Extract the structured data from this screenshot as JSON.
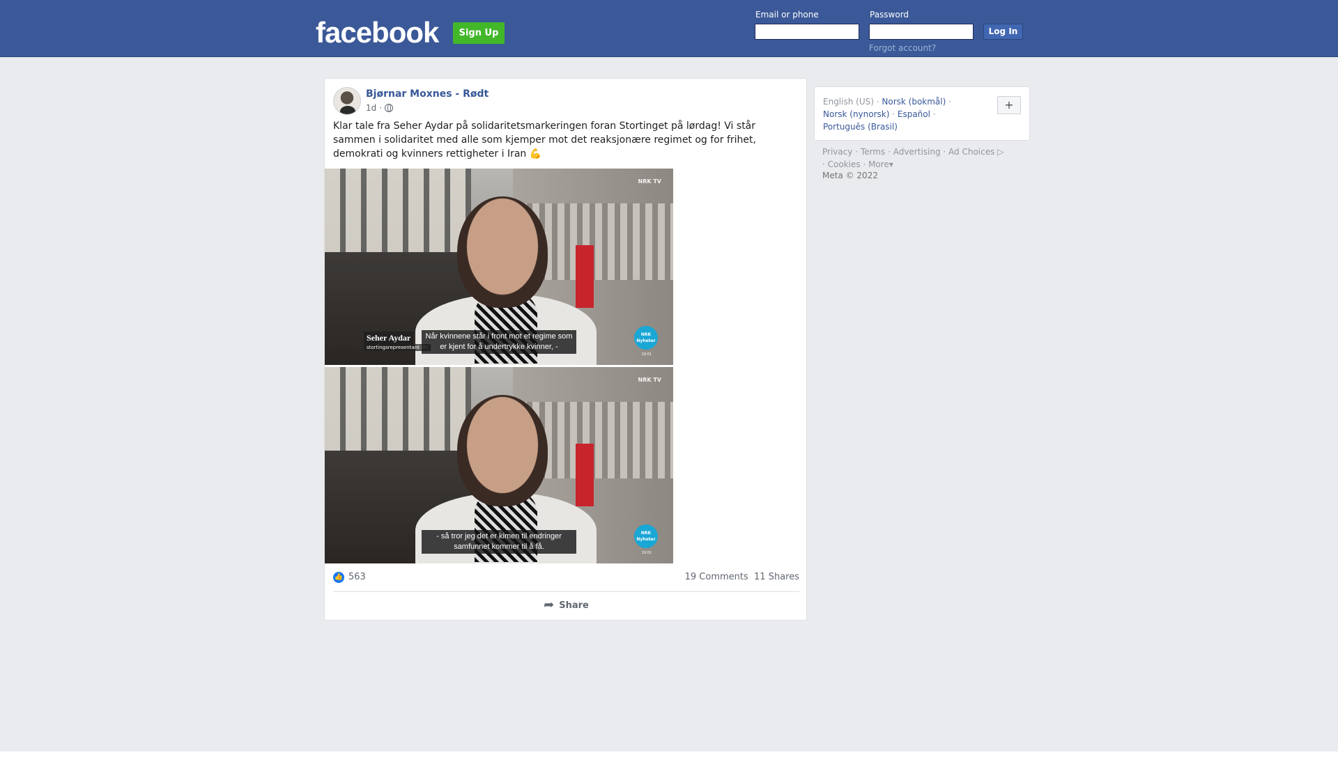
{
  "header": {
    "logo": "facebook",
    "signup_label": "Sign Up",
    "email_label": "Email or phone",
    "email_value": "",
    "password_label": "Password",
    "password_value": "",
    "login_label": "Log In",
    "forgot_label": "Forgot account?",
    "bg_color": "#3b5998"
  },
  "post": {
    "author": "Bjørnar Moxnes - Rødt",
    "time": "1d",
    "time_separator": "·",
    "privacy_icon": "globe-icon",
    "text": "Klar tale fra Seher Aydar på solidaritetsmarkeringen foran Stortinget på lørdag! Vi står sammen i solidaritet med alle som kjemper mot det reaksjonære regimet og for frihet, demokrati og kvinners rettigheter i Iran 💪",
    "photos": [
      {
        "caption": "Når kvinnene står i front mot et regime som er kjent for å undertrykke kvinner, -",
        "lower_third_name": "Seher Aydar",
        "lower_third_role": "stortingsrepresentant (R)",
        "channel": "NRK TV",
        "badge": "NRK Nyheter",
        "clock": "19:01"
      },
      {
        "caption": "- så tror jeg det er kimen til endringer samfunnet kommer til å få.",
        "channel": "NRK TV",
        "badge": "NRK Nyheter",
        "clock": "19:01"
      }
    ],
    "likes": "563",
    "comments": "19 Comments",
    "shares": "11 Shares",
    "share_label": "Share"
  },
  "languages": {
    "current": "English (US)",
    "others": [
      "Norsk (bokmål)",
      "Norsk (nynorsk)",
      "Español",
      "Português (Brasil)"
    ],
    "add_label": "+"
  },
  "footer": {
    "links": [
      "Privacy",
      "Terms",
      "Advertising",
      "Ad Choices",
      "Cookies",
      "More"
    ],
    "copyright": "Meta © 2022"
  }
}
